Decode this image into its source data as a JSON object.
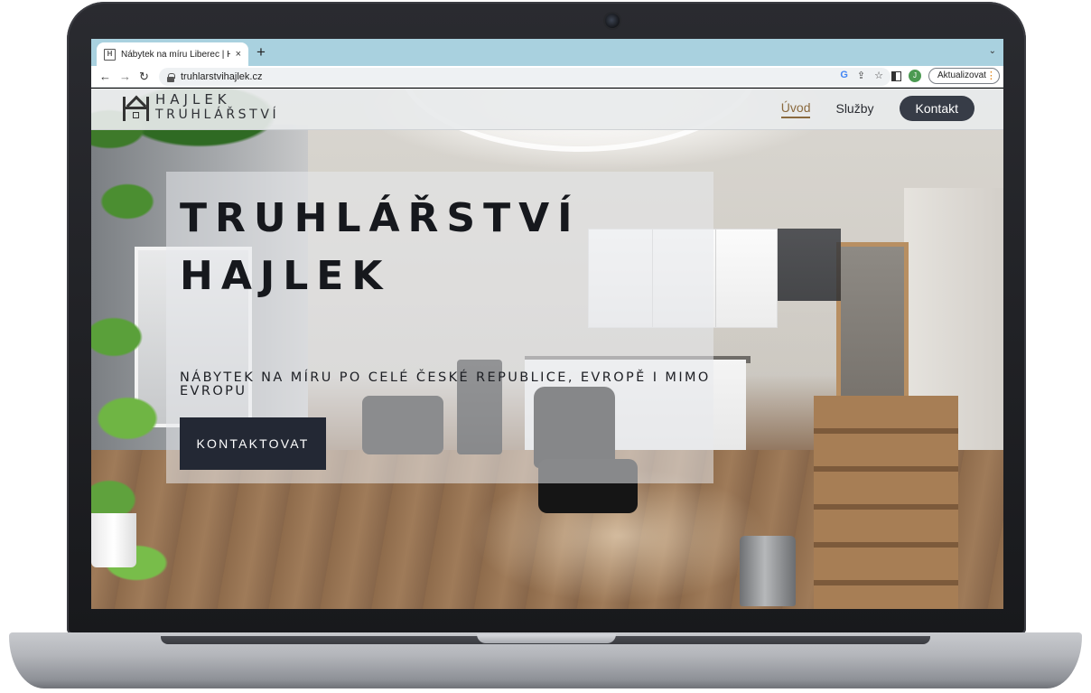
{
  "browser": {
    "tab_title": "Nábytek na míru Liberec | Hajlek",
    "tab_close": "×",
    "new_tab": "+",
    "tab_list": "⌄",
    "back": "←",
    "forward": "→",
    "reload": "↻",
    "url": "truhlarstvihajlek.cz",
    "profile_initial": "J",
    "update_label": "Aktualizovat",
    "omni_icons": {
      "google": "G",
      "share": "⇪",
      "bookmark": "☆"
    }
  },
  "site": {
    "logo": {
      "line1": "HAJLEK",
      "line2": "TRUHLÁŘSTVÍ"
    },
    "nav": {
      "home": "Úvod",
      "services": "Služby",
      "contact": "Kontakt"
    },
    "hero": {
      "title_line1": "TRUHLÁŘSTVÍ",
      "title_line2": "HAJLEK",
      "subtitle": "NÁBYTEK NA MÍRU PO CELÉ ČESKÉ REPUBLICE, EVROPĚ I MIMO EVROPU",
      "cta": "KONTAKTOVAT"
    }
  },
  "colors": {
    "tabbar": "#a9d1df",
    "nav_cta": "#373c47",
    "hero_cta": "#232834",
    "active_nav": "#8a6a3e"
  }
}
